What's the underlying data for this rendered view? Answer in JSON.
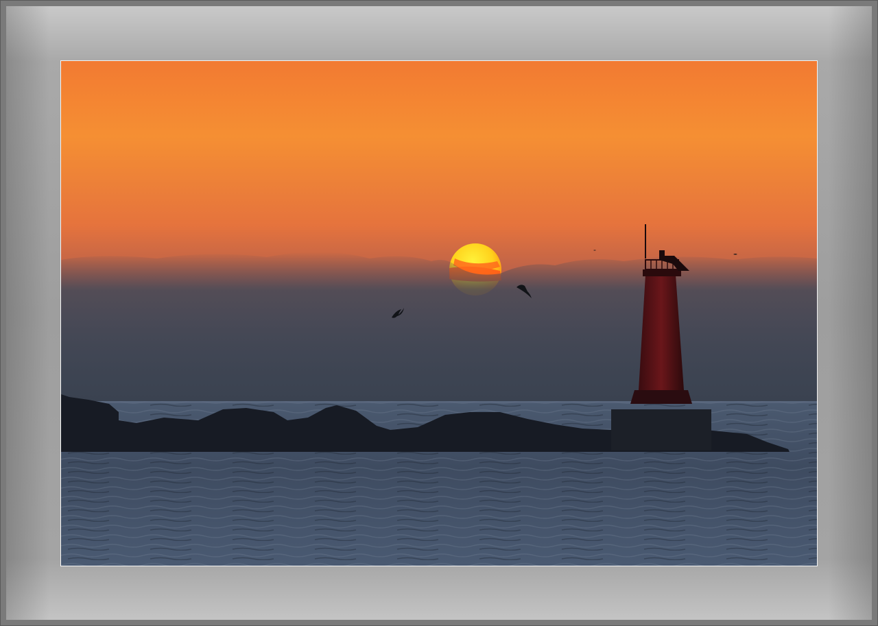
{
  "scene": {
    "subject": "lighthouse",
    "colors": {
      "sky_top": "#f08a3a",
      "sky_mid": "#e8743a",
      "sky_low": "#8a5a58",
      "haze": "#3e4452",
      "sea": "#3c4a5e",
      "sun_core": "#ffe020",
      "sun_edge": "#ff4a1a",
      "silhouette": "#161a22",
      "lighthouse_body": "#6a1418",
      "mat": "#a4a4a4"
    }
  }
}
